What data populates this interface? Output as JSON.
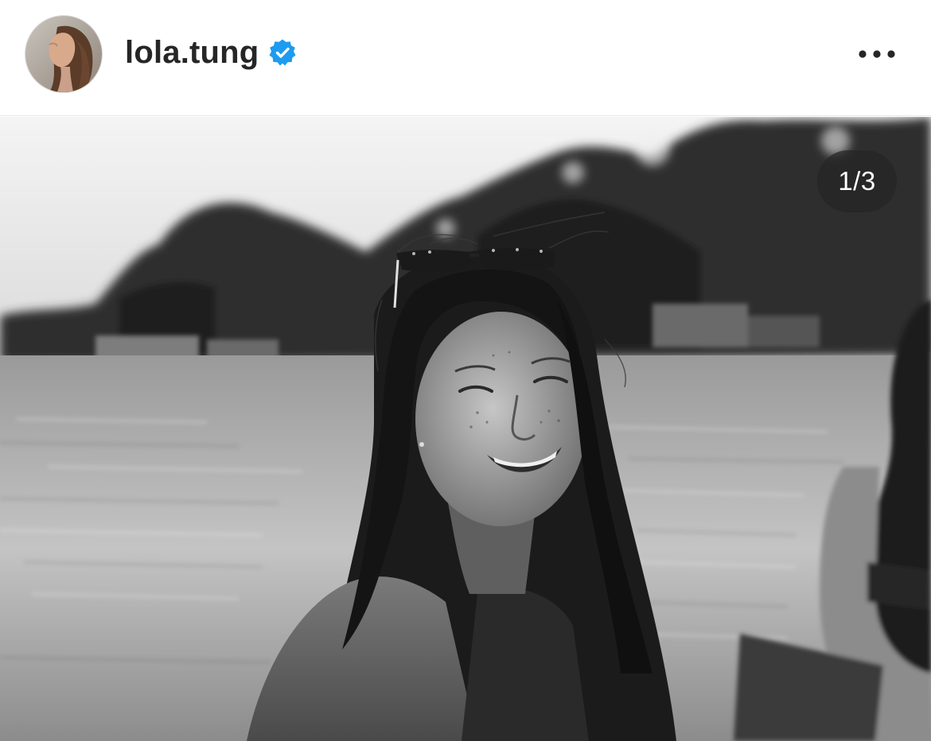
{
  "header": {
    "username": "lola.tung",
    "verified": true,
    "verified_color": "#1d9bf0",
    "avatar_icon": "profile-avatar",
    "more_icon": "more-horizontal-icon"
  },
  "media": {
    "counter": "1/3",
    "current_slide": 1,
    "total_slides": 3,
    "style": "black-and-white photo"
  }
}
